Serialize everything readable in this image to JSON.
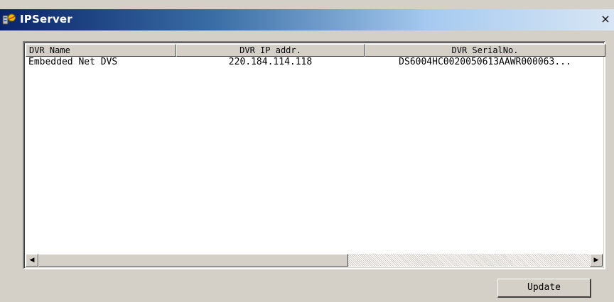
{
  "window": {
    "title": "IPServer",
    "close_glyph": "×",
    "app_icon": "network-app-icon",
    "colors": {
      "title_start": "#0a246a",
      "title_end": "#d8e6f4",
      "face": "#d4d0c8"
    }
  },
  "list": {
    "columns": [
      "DVR Name",
      "DVR IP addr.",
      "DVR SerialNo."
    ],
    "rows": [
      {
        "name": "Embedded Net DVS",
        "ip": "220.184.114.118",
        "serial": "DS6004HC0020050613AAWR000063..."
      }
    ]
  },
  "scrollbar": {
    "left_glyph": "◀",
    "right_glyph": "▶"
  },
  "buttons": {
    "update": "Update"
  }
}
